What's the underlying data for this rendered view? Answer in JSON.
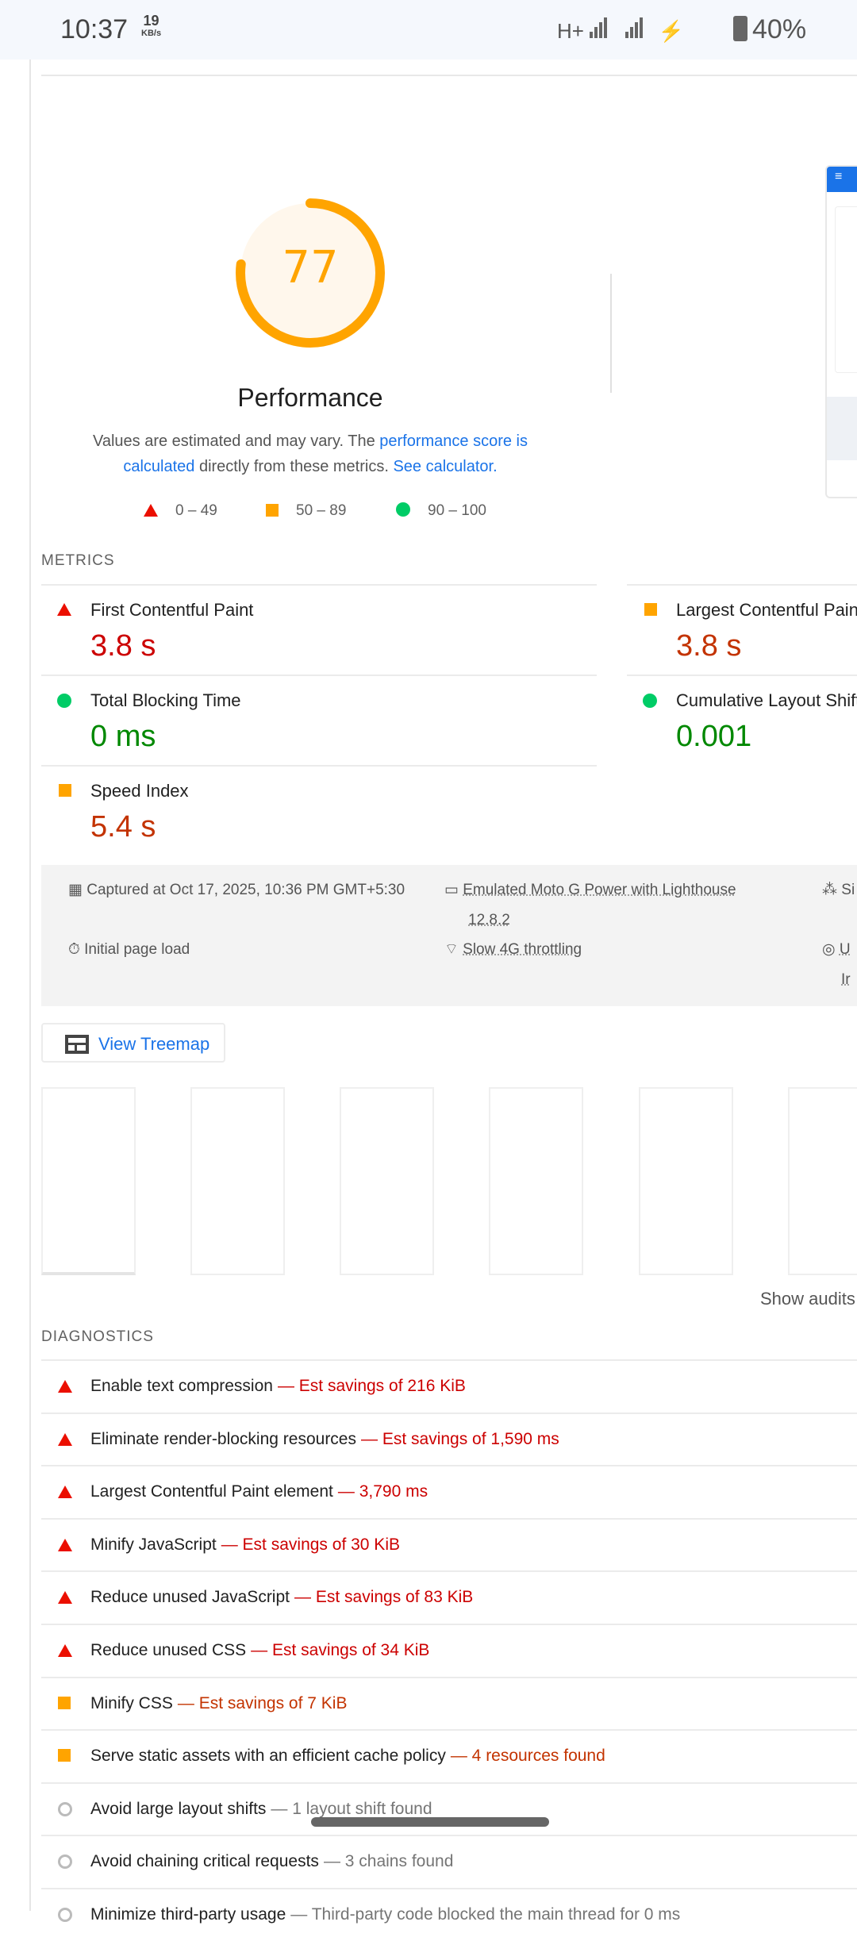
{
  "status_bar": {
    "time": "10:37",
    "net_speed": "19",
    "net_unit": "KB/s",
    "network": "H+",
    "battery": "40%"
  },
  "score": {
    "value": 77,
    "label": "Performance",
    "color": "#ffa400"
  },
  "description": {
    "text1": "Values are estimated and may vary. The ",
    "link1": "performance score is calculated",
    "text2": " directly from these metrics. ",
    "link2": "See calculator."
  },
  "legend": [
    {
      "range": "0 – 49",
      "icon": "triangle-icon"
    },
    {
      "range": "50 – 89",
      "icon": "square-icon"
    },
    {
      "range": "90 – 100",
      "icon": "circle-icon"
    }
  ],
  "screenshot_thumb": {
    "menu": "≡"
  },
  "metrics": {
    "title": "METRICS",
    "items": [
      {
        "name": "First Contentful Paint",
        "value": "3.8 s",
        "status": "fail"
      },
      {
        "name": "Largest Contentful Paint",
        "value": "3.8 s",
        "status": "average"
      },
      {
        "name": "Total Blocking Time",
        "value": "0 ms",
        "status": "pass"
      },
      {
        "name": "Cumulative Layout Shift",
        "value": "0.001",
        "status": "pass"
      },
      {
        "name": "Speed Index",
        "value": "5.4 s",
        "status": "average"
      }
    ]
  },
  "runtime": {
    "captured": "Captured at Oct 17, 2025, 10:36 PM GMT+5:30",
    "device": "Emulated Moto G Power with Lighthouse",
    "version": "12.8.2",
    "session": "Si",
    "load": "Initial page load",
    "throttling": "Slow 4G throttling",
    "browser1": "U",
    "browser2": "Ir"
  },
  "treemap_button": "View Treemap",
  "show_audits": "Show audits",
  "diagnostics": {
    "title": "DIAGNOSTICS",
    "items": [
      {
        "title": "Enable text compression",
        "detail": "— Est savings of 216 KiB",
        "status": "fail"
      },
      {
        "title": "Eliminate render-blocking resources",
        "detail": "— Est savings of 1,590 ms",
        "status": "fail"
      },
      {
        "title": "Largest Contentful Paint element",
        "detail": "— 3,790 ms",
        "status": "fail"
      },
      {
        "title": "Minify JavaScript",
        "detail": "— Est savings of 30 KiB",
        "status": "fail"
      },
      {
        "title": "Reduce unused JavaScript",
        "detail": "— Est savings of 83 KiB",
        "status": "fail"
      },
      {
        "title": "Reduce unused CSS",
        "detail": "— Est savings of 34 KiB",
        "status": "fail"
      },
      {
        "title": "Minify CSS",
        "detail": "— Est savings of 7 KiB",
        "status": "average"
      },
      {
        "title": "Serve static assets with an efficient cache policy",
        "detail": "— 4 resources found",
        "status": "average"
      },
      {
        "title": "Avoid large layout shifts",
        "detail": "— 1 layout shift found",
        "status": "info"
      },
      {
        "title": "Avoid chaining critical requests",
        "detail": "— 3 chains found",
        "status": "info"
      },
      {
        "title": "Minimize third-party usage",
        "detail": "— Third-party code blocked the main thread for 0 ms",
        "status": "info"
      }
    ]
  }
}
